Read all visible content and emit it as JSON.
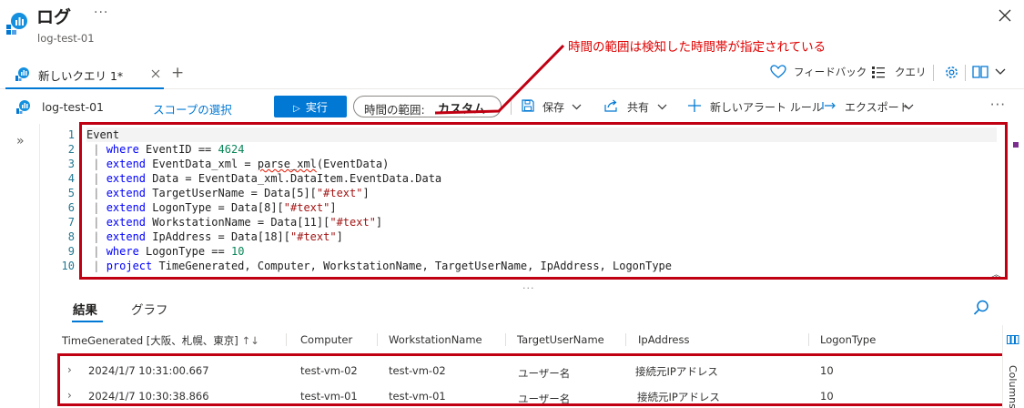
{
  "header": {
    "title": "ログ",
    "resource_name": "log-test-01"
  },
  "annotation": {
    "text": "時間の範囲は検知した時間帯が指定されている"
  },
  "tabs": {
    "active_tab_label": "新しいクエリ 1*",
    "add_label": "+"
  },
  "top_right": {
    "feedback_label": "フィードバック",
    "query_label": "クエリ"
  },
  "toolbar": {
    "workspace": "log-test-01",
    "scope_label": "スコープの選択",
    "run_label": "実行",
    "time_range_label": "時間の範囲:",
    "time_range_value": "カスタム",
    "save_label": "保存",
    "share_label": "共有",
    "new_alert_label": "新しいアラート ルール",
    "export_label": "エクスポート"
  },
  "editor": {
    "line_numbers": [
      "1",
      "2",
      "3",
      "4",
      "5",
      "6",
      "7",
      "8",
      "9",
      "10"
    ]
  },
  "results": {
    "tab_results": "結果",
    "tab_chart": "グラフ",
    "columns": [
      "TimeGenerated [大阪、札幌、東京]",
      "Computer",
      "WorkstationName",
      "TargetUserName",
      "IpAddress",
      "LogonType"
    ],
    "rows": [
      {
        "time": "2024/1/7 10:31:00.667",
        "computer": "test-vm-02",
        "workstation": "test-vm-02",
        "user": "ユーザー名",
        "ip": "接続元IPアドレス",
        "logon": "10"
      },
      {
        "time": "2024/1/7 10:30:38.866",
        "computer": "test-vm-01",
        "workstation": "test-vm-01",
        "user": "ユーザー名",
        "ip": "接続元IPアドレス",
        "logon": "10"
      }
    ],
    "columns_panel_label": "Columns"
  },
  "colors": {
    "accent": "#0078d4",
    "annotation_red": "#c00012"
  }
}
